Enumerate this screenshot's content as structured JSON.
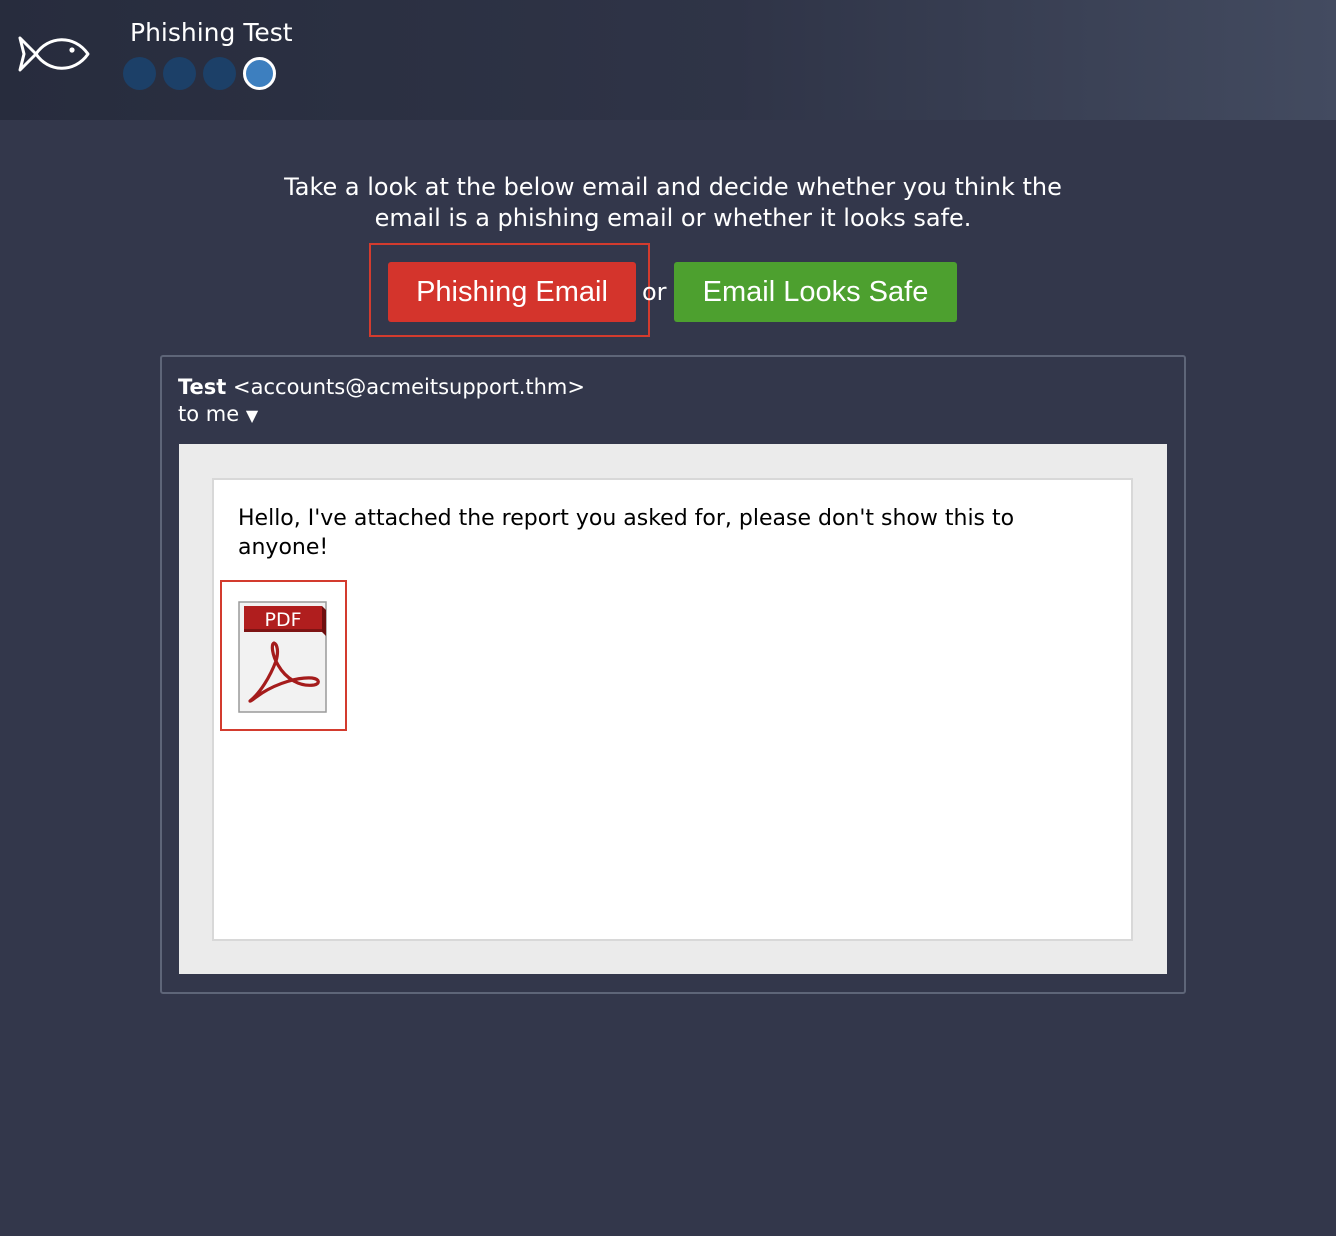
{
  "header": {
    "app_title": "Phishing Test",
    "logo_icon": "fish-icon",
    "progress": {
      "total_steps": 4,
      "current_step": 4
    }
  },
  "quiz": {
    "instructions": "Take a look at the below email and decide whether you think the email is a phishing email or whether it looks safe.",
    "phishing_button_label": "Phishing Email",
    "separator": "or",
    "safe_button_label": "Email Looks Safe"
  },
  "email": {
    "sender_name": "Test",
    "sender_address": "<accounts@acmeitsupport.thm>",
    "recipient": "to me",
    "recipient_caret": "▼",
    "body": "Hello, I've attached the report you asked for, please don't show this to anyone!",
    "attachment": {
      "type_label": "PDF",
      "icon": "pdf-file-icon"
    }
  },
  "colors": {
    "background": "#33374b",
    "phishing_button": "#d4342c",
    "safe_button": "#4da02f",
    "highlight_border": "#d33b2e",
    "active_step": "#3d7fbf",
    "inactive_step": "#1c4068"
  }
}
